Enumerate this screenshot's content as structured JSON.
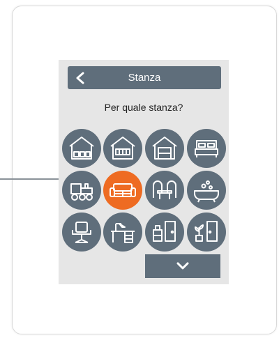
{
  "header": {
    "title": "Stanza",
    "back_icon": "chevron-left-icon"
  },
  "prompt": "Per quale stanza?",
  "rooms": [
    {
      "icon": "house-storage-icon",
      "selected": false
    },
    {
      "icon": "house-window-icon",
      "selected": false
    },
    {
      "icon": "house-door-icon",
      "selected": false
    },
    {
      "icon": "bed-icon",
      "selected": false
    },
    {
      "icon": "toy-train-icon",
      "selected": false
    },
    {
      "icon": "sofa-icon",
      "selected": true
    },
    {
      "icon": "dining-chairs-icon",
      "selected": false
    },
    {
      "icon": "bathtub-icon",
      "selected": false
    },
    {
      "icon": "office-chair-icon",
      "selected": false
    },
    {
      "icon": "desk-lamp-icon",
      "selected": false
    },
    {
      "icon": "cabinet-door-icon",
      "selected": false
    },
    {
      "icon": "plant-door-icon",
      "selected": false
    }
  ],
  "footer": {
    "next_icon": "chevron-down-icon"
  },
  "colors": {
    "button": "#5f6e7b",
    "selected": "#ee6b22",
    "screen": "#e6e6e6"
  }
}
